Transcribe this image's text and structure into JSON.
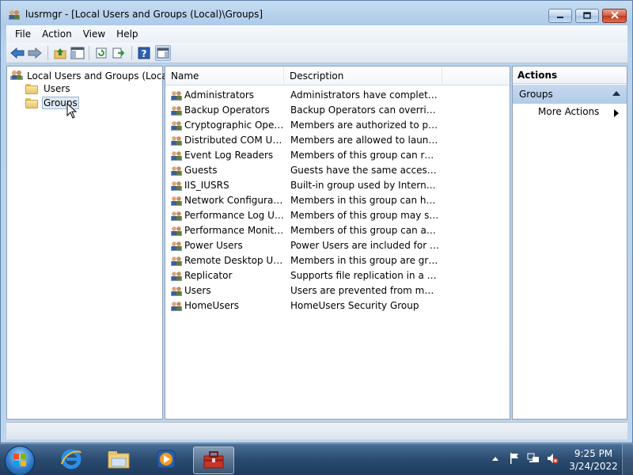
{
  "window": {
    "title": "lusrmgr - [Local Users and Groups (Local)\\Groups]"
  },
  "menubar": {
    "items": [
      {
        "label": "File"
      },
      {
        "label": "Action"
      },
      {
        "label": "View"
      },
      {
        "label": "Help"
      }
    ]
  },
  "toolbar": {
    "icons": [
      "back-arrow-icon",
      "forward-arrow-icon",
      "up-folder-icon",
      "show-hide-tree-icon",
      "refresh-icon",
      "export-list-icon",
      "help-icon",
      "show-hide-action-pane-icon"
    ]
  },
  "tree": {
    "root_label": "Local Users and Groups (Local)",
    "children": [
      {
        "label": "Users"
      },
      {
        "label": "Groups"
      }
    ],
    "selected": "Groups"
  },
  "list": {
    "columns": [
      "Name",
      "Description"
    ],
    "rows": [
      {
        "name": "Administrators",
        "description": "Administrators have complete an..."
      },
      {
        "name": "Backup Operators",
        "description": "Backup Operators can override se..."
      },
      {
        "name": "Cryptographic Operat...",
        "description": "Members are authorized to perfor..."
      },
      {
        "name": "Distributed COM Users",
        "description": "Members are allowed to launch, a..."
      },
      {
        "name": "Event Log Readers",
        "description": "Members of this group can read e..."
      },
      {
        "name": "Guests",
        "description": "Guests have the same access as m..."
      },
      {
        "name": "IIS_IUSRS",
        "description": "Built-in group used by Internet Inf..."
      },
      {
        "name": "Network Configuratio...",
        "description": "Members in this group can have s..."
      },
      {
        "name": "Performance Log Users",
        "description": "Members of this group may sche..."
      },
      {
        "name": "Performance Monitor ...",
        "description": "Members of this group can acces..."
      },
      {
        "name": "Power Users",
        "description": "Power Users are included for back..."
      },
      {
        "name": "Remote Desktop Users",
        "description": "Members in this group are grante..."
      },
      {
        "name": "Replicator",
        "description": "Supports file replication in a dom..."
      },
      {
        "name": "Users",
        "description": "Users are prevented from making ..."
      },
      {
        "name": "HomeUsers",
        "description": "HomeUsers Security Group"
      }
    ]
  },
  "actions": {
    "title": "Actions",
    "section": "Groups",
    "more_actions": "More Actions"
  },
  "taskbar": {
    "apps": [
      "internet-explorer-icon",
      "windows-explorer-icon",
      "media-player-icon",
      "computer-management-toolbox-icon"
    ],
    "active_app": "computer-management-toolbox-icon",
    "clock": {
      "time": "9:25 PM",
      "date": "3/24/2022"
    }
  }
}
